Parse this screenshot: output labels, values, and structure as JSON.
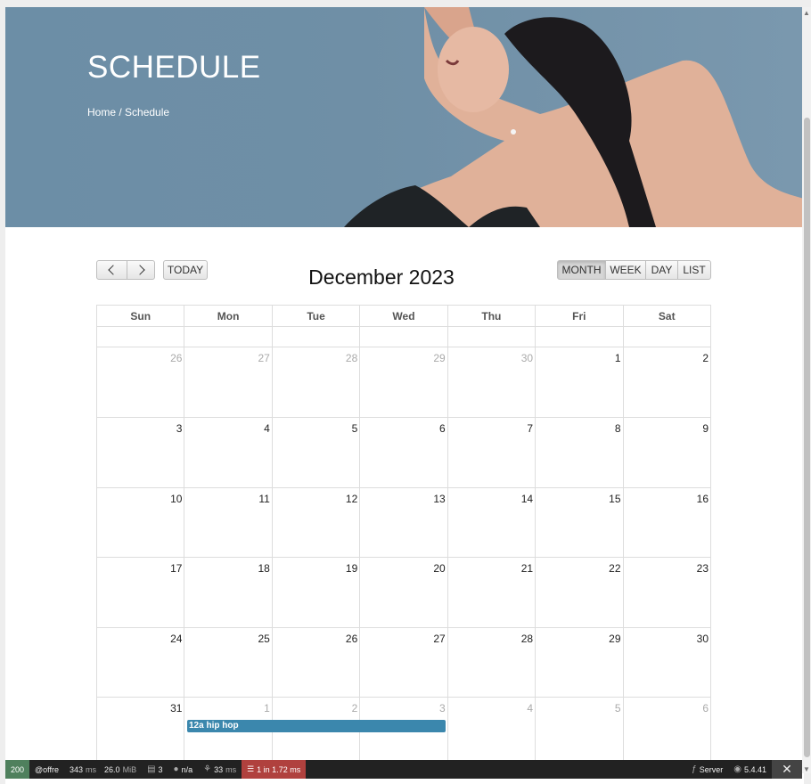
{
  "hero": {
    "title": "SCHEDULE",
    "breadcrumb": "Home / Schedule"
  },
  "toolbar": {
    "today_label": "TODAY",
    "title": "December 2023",
    "views": [
      "MONTH",
      "WEEK",
      "DAY",
      "LIST"
    ],
    "active_view": "MONTH"
  },
  "calendar": {
    "weekdays": [
      "Sun",
      "Mon",
      "Tue",
      "Wed",
      "Thu",
      "Fri",
      "Sat"
    ],
    "weeks": [
      [
        {
          "d": "26",
          "o": true
        },
        {
          "d": "27",
          "o": true
        },
        {
          "d": "28",
          "o": true
        },
        {
          "d": "29",
          "o": true
        },
        {
          "d": "30",
          "o": true
        },
        {
          "d": "1"
        },
        {
          "d": "2"
        }
      ],
      [
        {
          "d": "3"
        },
        {
          "d": "4"
        },
        {
          "d": "5"
        },
        {
          "d": "6"
        },
        {
          "d": "7"
        },
        {
          "d": "8"
        },
        {
          "d": "9"
        }
      ],
      [
        {
          "d": "10"
        },
        {
          "d": "11"
        },
        {
          "d": "12"
        },
        {
          "d": "13"
        },
        {
          "d": "14"
        },
        {
          "d": "15"
        },
        {
          "d": "16"
        }
      ],
      [
        {
          "d": "17"
        },
        {
          "d": "18"
        },
        {
          "d": "19"
        },
        {
          "d": "20"
        },
        {
          "d": "21"
        },
        {
          "d": "22"
        },
        {
          "d": "23"
        }
      ],
      [
        {
          "d": "24"
        },
        {
          "d": "25"
        },
        {
          "d": "26"
        },
        {
          "d": "27"
        },
        {
          "d": "28"
        },
        {
          "d": "29"
        },
        {
          "d": "30"
        }
      ],
      [
        {
          "d": "31"
        },
        {
          "d": "1",
          "o": true
        },
        {
          "d": "2",
          "o": true
        },
        {
          "d": "3",
          "o": true
        },
        {
          "d": "4",
          "o": true
        },
        {
          "d": "5",
          "o": true
        },
        {
          "d": "6",
          "o": true
        }
      ]
    ],
    "event": {
      "label": "12a hip hop",
      "color": "#3b87ad"
    }
  },
  "debug_toolbar": {
    "status": "200",
    "route": "@offre",
    "time": "343",
    "time_unit": "ms",
    "memory": "26.0",
    "memory_unit": "MiB",
    "logs": "3",
    "user": "n/a",
    "twig": "33",
    "twig_unit": "ms",
    "db": "1 in 1.72 ms",
    "server": "Server",
    "version": "5.4.41",
    "status_color": "#4f805d",
    "db_color": "#b0413e"
  }
}
